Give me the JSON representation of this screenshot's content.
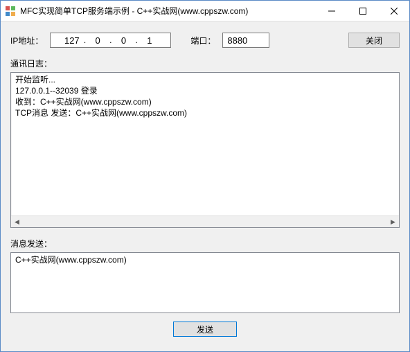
{
  "window": {
    "title": "MFC实现简单TCP服务端示例 - C++实战网(www.cppszw.com)"
  },
  "form": {
    "ip_label": "IP地址：",
    "ip": {
      "a": "127",
      "b": "0",
      "c": "0",
      "d": "1"
    },
    "port_label": "端口：",
    "port_value": "8880",
    "close_btn": "关闭"
  },
  "log": {
    "label": "通讯日志：",
    "text": "开始监听...\n127.0.0.1--32039 登录\n收到：C++实战网(www.cppszw.com)\nTCP消息 发送：C++实战网(www.cppszw.com)"
  },
  "send": {
    "label": "消息发送：",
    "text": "C++实战网(www.cppszw.com)",
    "button": "发送"
  }
}
